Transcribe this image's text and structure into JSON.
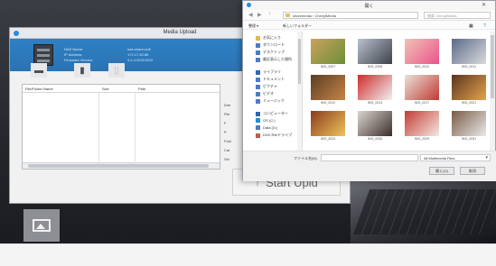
{
  "media_upload": {
    "title": "Media Upload",
    "device_info": {
      "keys": [
        "NAS Name:",
        "IP Address:",
        "Firmware Version:"
      ],
      "values": [
        "nas-share-unit",
        "172.17.52.86",
        "4.1.4.20210303"
      ]
    },
    "file_table": {
      "headers": [
        "File/Folder Name",
        "Size",
        "Path"
      ]
    },
    "side_labels": [
      "Dire",
      "File",
      "F",
      "P",
      "Fold",
      "Cat",
      "Sel"
    ],
    "start_button": "Start Upld"
  },
  "open_dialog": {
    "title": "開く",
    "address": "sharemedia › ChenyiMedia",
    "search_placeholder": "検索 ChenyiMedia",
    "commands": [
      "整理 ▾",
      "新しいフォルダー"
    ],
    "tree": [
      "お気に入り",
      "ダウンロード",
      "デスクトップ",
      "最近表示した場所",
      "ライブラリ",
      "ドキュメント",
      "ピクチャ",
      "ビデオ",
      "ミュージック",
      "コンピューター",
      "OS (C:)",
      "Data (D:)",
      "DVD RWドライブ"
    ],
    "photos": [
      {
        "label": "IMG_0007",
        "colors": [
          "#caa25c",
          "#6b8f3a"
        ]
      },
      {
        "label": "IMG_0008",
        "colors": [
          "#b9c2cf",
          "#3d4048"
        ]
      },
      {
        "label": "IMG_0010",
        "colors": [
          "#f2c3b5",
          "#e8548b"
        ]
      },
      {
        "label": "IMG_0011",
        "colors": [
          "#5c6b88",
          "#d9d9dc"
        ]
      },
      {
        "label": "IMG_0012",
        "colors": [
          "#5b3c23",
          "#c78547"
        ]
      },
      {
        "label": "IMG_0013",
        "colors": [
          "#d12a2a",
          "#f1f1f1"
        ]
      },
      {
        "label": "IMG_0017",
        "colors": [
          "#e9e2da",
          "#c23a32"
        ]
      },
      {
        "label": "IMG_0021",
        "colors": [
          "#5a3420",
          "#e5a44c"
        ]
      },
      {
        "label": "IMG_0024",
        "colors": [
          "#8a3b1e",
          "#f0c35a"
        ]
      },
      {
        "label": "IMG_0026",
        "colors": [
          "#dcd6d0",
          "#3b2d2a"
        ]
      },
      {
        "label": "IMG_0029",
        "colors": [
          "#c33b32",
          "#f4e9e3"
        ]
      },
      {
        "label": "IMG_0031",
        "colors": [
          "#7a5a44",
          "#eaeaea"
        ]
      }
    ],
    "file_name_label": "ファイル名(N):",
    "file_type": "All Multimedia Files",
    "open_button": "開く(O)",
    "cancel_button": "取消"
  }
}
